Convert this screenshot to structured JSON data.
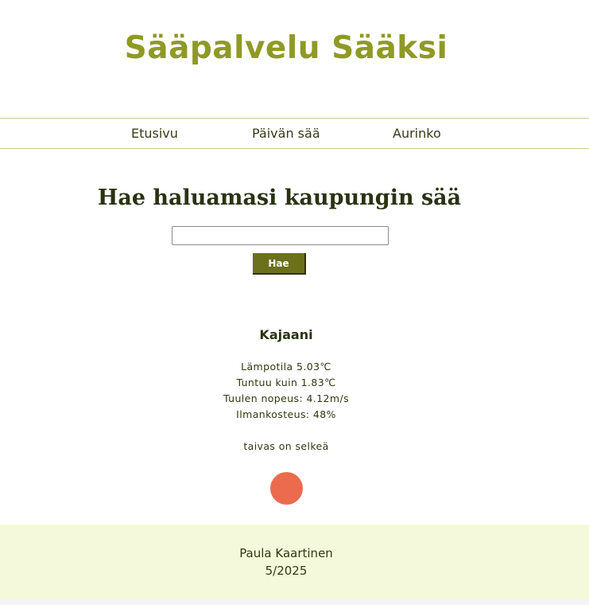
{
  "header": {
    "title": "Sääpalvelu Sääksi"
  },
  "nav": {
    "items": [
      {
        "label": "Etusivu"
      },
      {
        "label": "Päivän sää"
      },
      {
        "label": "Aurinko"
      }
    ]
  },
  "search": {
    "heading": "Hae haluamasi kaupungin sää",
    "input_value": "",
    "placeholder": "",
    "button_label": "Hae"
  },
  "weather": {
    "city": "Kajaani",
    "temperature": "Lämpotila 5.03℃",
    "feels_like": "Tuntuu kuin 1.83℃",
    "wind": "Tuulen nopeus: 4.12m/s",
    "humidity": "Ilmankosteus: 48%",
    "description": "taivas on selkeä",
    "icon": "sun-icon"
  },
  "footer": {
    "author": "Paula Kaartinen",
    "date": "5/2025"
  },
  "colors": {
    "title": "#8f9a24",
    "button": "#6b701a",
    "sun": "#ec6b4f",
    "footer_bg": "#f5f9db",
    "nav_border": "#c6cc96"
  }
}
